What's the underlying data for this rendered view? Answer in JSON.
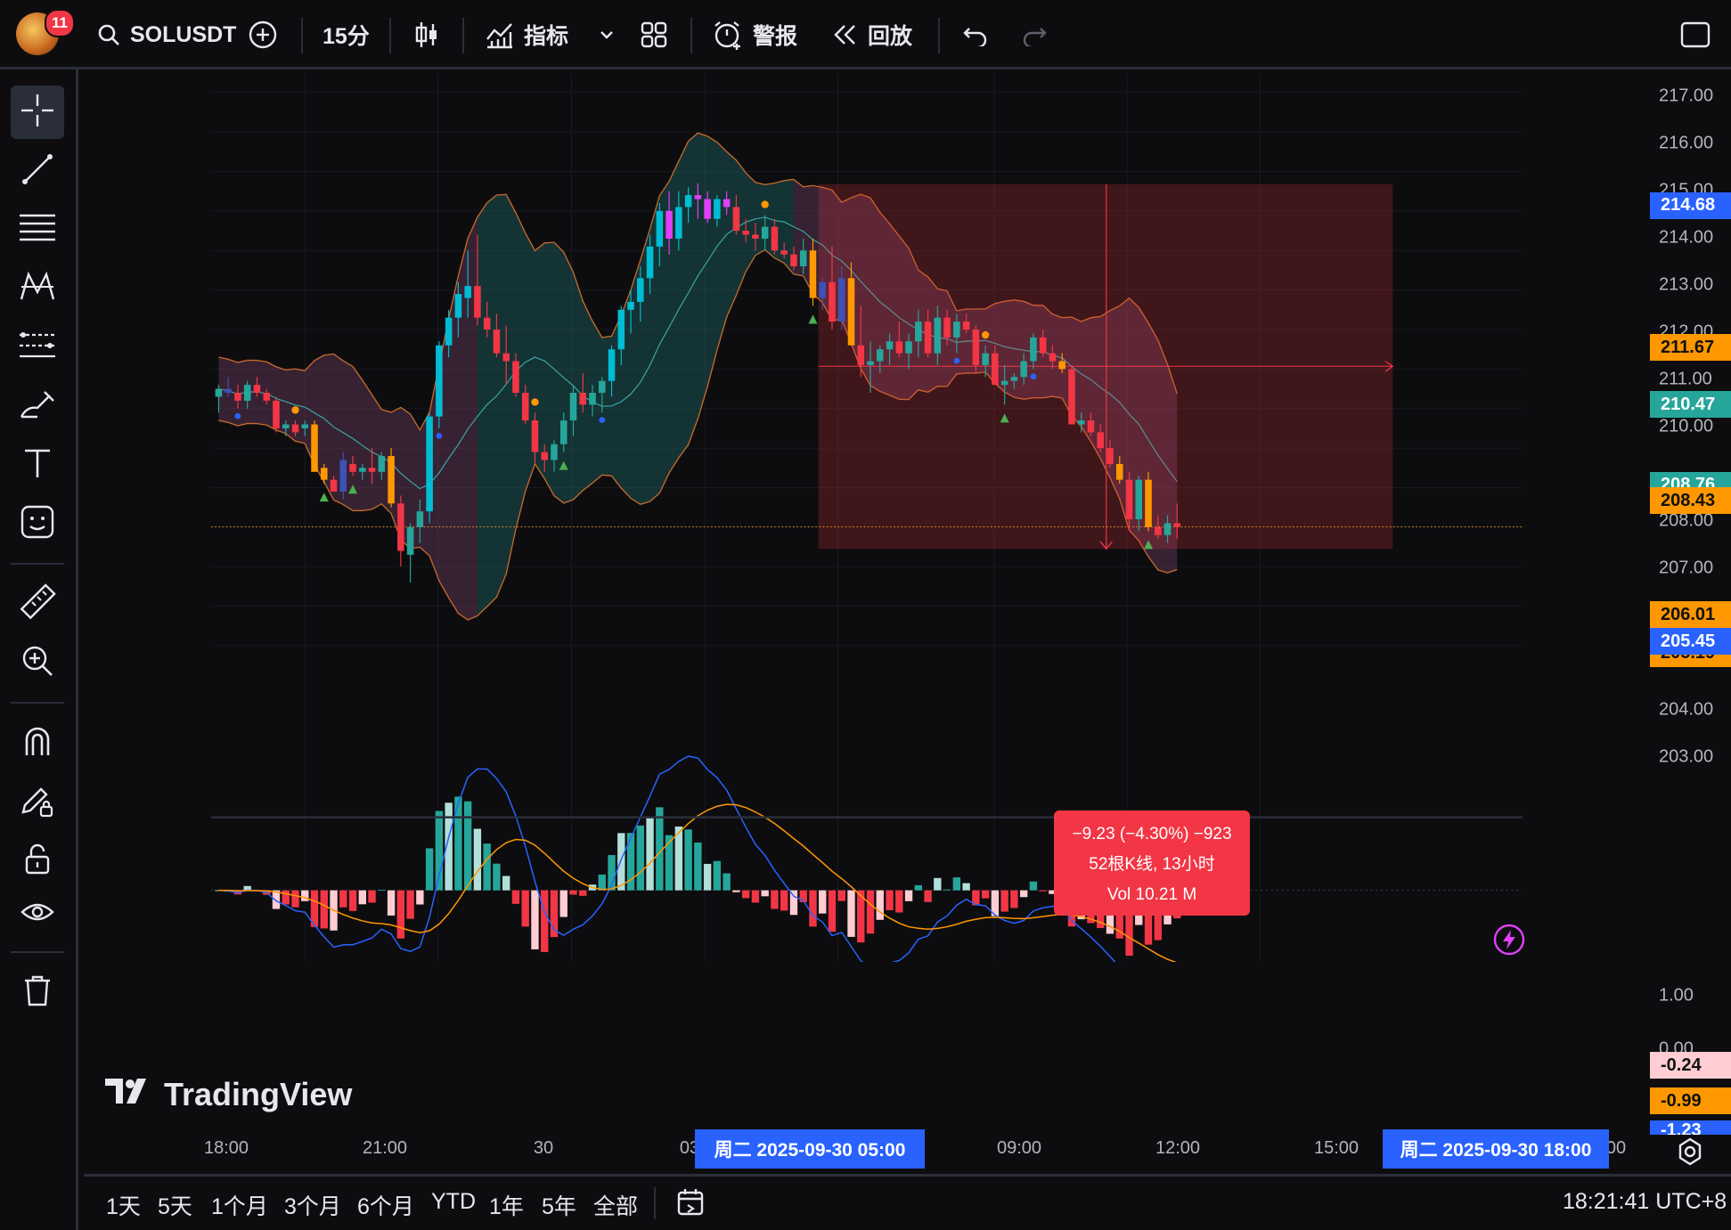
{
  "topbar": {
    "notification_count": "11",
    "symbol": "SOLUSDT",
    "interval": "15分",
    "indicators_label": "指标",
    "alert_label": "警报",
    "replay_label": "回放"
  },
  "price_axis": {
    "labels": [
      "217.00",
      "216.00",
      "215.00",
      "214.00",
      "213.00",
      "212.00",
      "211.00",
      "210.00",
      "208.00",
      "207.00",
      "204.00",
      "203.00"
    ],
    "macd_labels": [
      "1.00",
      "0.00"
    ],
    "tags": {
      "box_top": "214.68",
      "upper_band": "211.67",
      "crosshair": "210.47",
      "middle": "208.76",
      "mid_orange": "208.43",
      "last_price": "206.01",
      "box_bottom": "205.45",
      "lower_band": "205.19",
      "macd_hist": "-0.24",
      "macd_signal": "-0.99",
      "macd_line": "-1.23"
    }
  },
  "time_axis": {
    "labels": [
      "18:00",
      "21:00",
      "30",
      "03",
      "09:00",
      "12:00",
      "15:00",
      "00"
    ],
    "highlight_start": "周二 2025-09-30   05:00",
    "highlight_end": "周二 2025-09-30   18:00"
  },
  "measure_tooltip": {
    "line1": "−9.23 (−4.30%) −923",
    "line2": "52根K线, 13小时",
    "line3": "Vol 10.21 M"
  },
  "watermark": "TradingView",
  "ranges": [
    "1天",
    "5天",
    "1个月",
    "3个月",
    "6个月",
    "YTD",
    "1年",
    "5年",
    "全部"
  ],
  "clock": "18:21:41 UTC+8",
  "colors": {
    "up": "#26a69a",
    "down": "#f23645",
    "accent": "#2962ff",
    "orange": "#ff9800",
    "cyan": "#00bcd4",
    "magenta": "#e040fb",
    "blue": "#3f51b5"
  },
  "chart_data": {
    "type": "candlestick",
    "symbol": "SOLUSDT",
    "interval": "15分",
    "ylim": [
      202.7,
      217.4
    ],
    "candles": [
      [
        209.3,
        209.6,
        208.9,
        209.5
      ],
      [
        209.5,
        209.8,
        209.3,
        209.4
      ],
      [
        209.4,
        209.6,
        209.0,
        209.2
      ],
      [
        209.2,
        209.7,
        209.0,
        209.6
      ],
      [
        209.6,
        209.8,
        209.3,
        209.4
      ],
      [
        209.4,
        209.5,
        209.1,
        209.2
      ],
      [
        209.2,
        209.3,
        208.4,
        208.5
      ],
      [
        208.5,
        208.7,
        208.3,
        208.6
      ],
      [
        208.6,
        208.7,
        208.3,
        208.4
      ],
      [
        208.5,
        208.7,
        208.3,
        208.6
      ],
      [
        208.6,
        208.7,
        207.5,
        207.4
      ],
      [
        207.5,
        207.6,
        207.1,
        207.2
      ],
      [
        207.2,
        207.3,
        206.9,
        206.9
      ],
      [
        206.9,
        207.9,
        206.7,
        207.7
      ],
      [
        207.6,
        207.8,
        207.3,
        207.4
      ],
      [
        207.4,
        207.6,
        207.2,
        207.5
      ],
      [
        207.5,
        208.0,
        207.1,
        207.4
      ],
      [
        207.4,
        207.9,
        207.2,
        207.8
      ],
      [
        207.8,
        208.0,
        206.5,
        206.6
      ],
      [
        206.6,
        206.8,
        205.0,
        205.4
      ],
      [
        205.3,
        206.1,
        204.6,
        206.0
      ],
      [
        206.0,
        206.7,
        205.6,
        206.4
      ],
      [
        206.4,
        208.9,
        206.1,
        208.8
      ],
      [
        208.8,
        210.7,
        208.5,
        210.6
      ],
      [
        210.6,
        211.5,
        210.3,
        211.3
      ],
      [
        211.3,
        212.2,
        210.8,
        211.9
      ],
      [
        211.8,
        213.0,
        211.3,
        212.1
      ],
      [
        212.1,
        213.4,
        211.1,
        211.3
      ],
      [
        211.3,
        211.7,
        210.8,
        211.0
      ],
      [
        211.0,
        211.4,
        210.3,
        210.4
      ],
      [
        210.4,
        211.1,
        209.6,
        210.2
      ],
      [
        210.2,
        210.4,
        209.3,
        209.4
      ],
      [
        209.4,
        209.6,
        208.6,
        208.7
      ],
      [
        208.7,
        208.9,
        207.6,
        207.9
      ],
      [
        207.9,
        208.1,
        207.4,
        207.7
      ],
      [
        207.7,
        208.2,
        207.4,
        208.1
      ],
      [
        208.1,
        208.9,
        207.9,
        208.7
      ],
      [
        208.7,
        209.6,
        208.3,
        209.4
      ],
      [
        209.4,
        209.9,
        208.9,
        209.1
      ],
      [
        209.1,
        209.6,
        208.8,
        209.4
      ],
      [
        209.4,
        209.8,
        208.9,
        209.7
      ],
      [
        209.7,
        210.6,
        209.3,
        210.5
      ],
      [
        210.5,
        211.6,
        210.1,
        211.5
      ],
      [
        211.5,
        212.0,
        210.9,
        211.7
      ],
      [
        211.7,
        212.6,
        211.2,
        212.3
      ],
      [
        212.3,
        213.4,
        211.9,
        213.1
      ],
      [
        213.1,
        214.2,
        212.6,
        214.0
      ],
      [
        214.0,
        214.5,
        212.9,
        213.3
      ],
      [
        213.3,
        214.5,
        213.0,
        214.1
      ],
      [
        214.1,
        214.6,
        213.7,
        214.4
      ],
      [
        214.4,
        214.7,
        213.8,
        214.3
      ],
      [
        214.3,
        214.5,
        213.7,
        213.8
      ],
      [
        213.8,
        214.4,
        213.6,
        214.3
      ],
      [
        214.3,
        214.5,
        213.9,
        214.1
      ],
      [
        214.1,
        214.4,
        213.4,
        213.5
      ],
      [
        213.5,
        213.8,
        213.2,
        213.4
      ],
      [
        213.4,
        213.7,
        213.0,
        213.3
      ],
      [
        213.3,
        213.9,
        213.0,
        213.6
      ],
      [
        213.6,
        213.8,
        212.9,
        213.0
      ],
      [
        213.0,
        213.2,
        212.8,
        212.9
      ],
      [
        212.9,
        213.1,
        212.5,
        212.6
      ],
      [
        212.6,
        213.3,
        212.4,
        213.0
      ],
      [
        213.0,
        213.3,
        211.6,
        211.8
      ],
      [
        211.8,
        212.3,
        211.5,
        212.2
      ],
      [
        212.2,
        213.1,
        211.0,
        211.2
      ],
      [
        211.2,
        212.6,
        211.0,
        212.3
      ],
      [
        212.3,
        212.7,
        210.7,
        210.6
      ],
      [
        210.6,
        211.6,
        209.8,
        210.1
      ],
      [
        210.1,
        210.7,
        209.4,
        210.2
      ],
      [
        210.2,
        210.6,
        209.9,
        210.5
      ],
      [
        210.5,
        210.9,
        210.1,
        210.7
      ],
      [
        210.7,
        211.2,
        210.3,
        210.4
      ],
      [
        210.4,
        210.9,
        210.0,
        210.7
      ],
      [
        210.7,
        211.5,
        210.3,
        211.2
      ],
      [
        211.2,
        211.5,
        210.3,
        210.4
      ],
      [
        210.4,
        211.6,
        210.1,
        211.3
      ],
      [
        211.3,
        211.5,
        210.6,
        210.8
      ],
      [
        210.8,
        211.4,
        210.4,
        211.2
      ],
      [
        211.2,
        211.4,
        210.9,
        211.0
      ],
      [
        211.0,
        211.1,
        209.9,
        210.1
      ],
      [
        210.1,
        210.6,
        209.8,
        210.4
      ],
      [
        210.4,
        210.6,
        209.6,
        209.6
      ],
      [
        209.6,
        210.1,
        209.1,
        209.7
      ],
      [
        209.7,
        209.9,
        209.5,
        209.8
      ],
      [
        209.8,
        210.4,
        209.6,
        210.2
      ],
      [
        210.2,
        210.9,
        210.0,
        210.8
      ],
      [
        210.8,
        211.0,
        210.3,
        210.4
      ],
      [
        210.4,
        210.6,
        210.0,
        210.2
      ],
      [
        210.2,
        210.4,
        209.9,
        210.0
      ],
      [
        210.0,
        210.1,
        208.6,
        208.6
      ],
      [
        208.6,
        208.9,
        208.4,
        208.7
      ],
      [
        208.7,
        208.9,
        208.3,
        208.4
      ],
      [
        208.4,
        208.6,
        207.9,
        208.0
      ],
      [
        208.0,
        208.2,
        207.5,
        207.6
      ],
      [
        207.6,
        207.8,
        207.1,
        207.2
      ],
      [
        207.2,
        207.4,
        205.9,
        206.2
      ],
      [
        206.2,
        207.3,
        205.9,
        207.2
      ],
      [
        207.2,
        207.4,
        205.9,
        206.0
      ],
      [
        206.0,
        206.3,
        205.7,
        205.8
      ],
      [
        205.8,
        206.3,
        205.6,
        206.1
      ],
      [
        206.1,
        206.6,
        205.7,
        206.01
      ]
    ],
    "measure": {
      "from_price": 214.68,
      "to_price": 205.45,
      "change": "−9.23 (−4.30%) −923",
      "bars": "52根K线, 13小时",
      "volume": "Vol 10.21 M"
    },
    "last_price": 206.01,
    "macd": {
      "macd": -1.23,
      "signal": -0.99,
      "histogram": -0.24
    }
  }
}
